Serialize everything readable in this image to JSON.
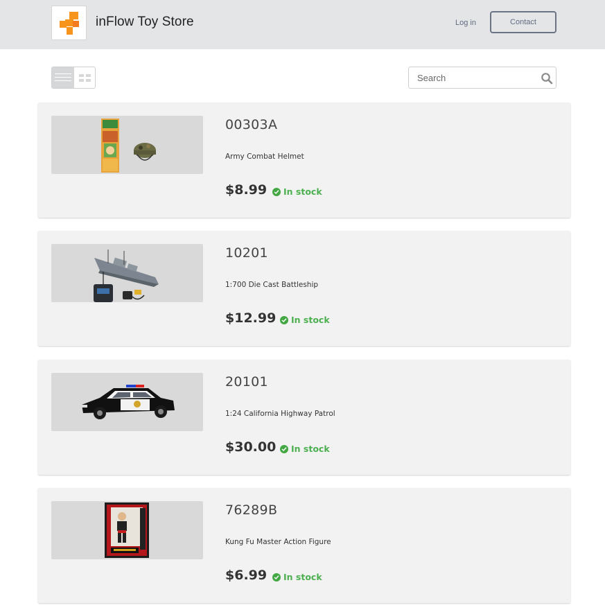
{
  "header": {
    "store_name": "inFlow Toy Store",
    "login_label": "Log in",
    "contact_label": "Contact",
    "brand_colors": [
      "#f7941d",
      "#f15a24"
    ]
  },
  "toolbar": {
    "view_modes": [
      "list",
      "grid"
    ],
    "active_view": "list",
    "search_placeholder": "Search",
    "search_value": ""
  },
  "products": [
    {
      "sku": "00303A",
      "name": "Army Combat Helmet",
      "price": "$8.99",
      "stock": "In stock",
      "image_icon": "helmet-toy-image"
    },
    {
      "sku": "10201",
      "name": "1:700 Die Cast Battleship",
      "price": "$12.99",
      "stock": "In stock",
      "image_icon": "battleship-toy-image"
    },
    {
      "sku": "20101",
      "name": "1:24 California Highway Patrol",
      "price": "$30.00",
      "stock": "In stock",
      "image_icon": "police-car-toy-image"
    },
    {
      "sku": "76289B",
      "name": "Kung Fu Master Action Figure",
      "price": "$6.99",
      "stock": "In stock",
      "image_icon": "action-figure-toy-image"
    }
  ],
  "colors": {
    "header_bg": "#e4e5e7",
    "card_bg": "#f2f2f2",
    "in_stock": "#4caf50"
  }
}
